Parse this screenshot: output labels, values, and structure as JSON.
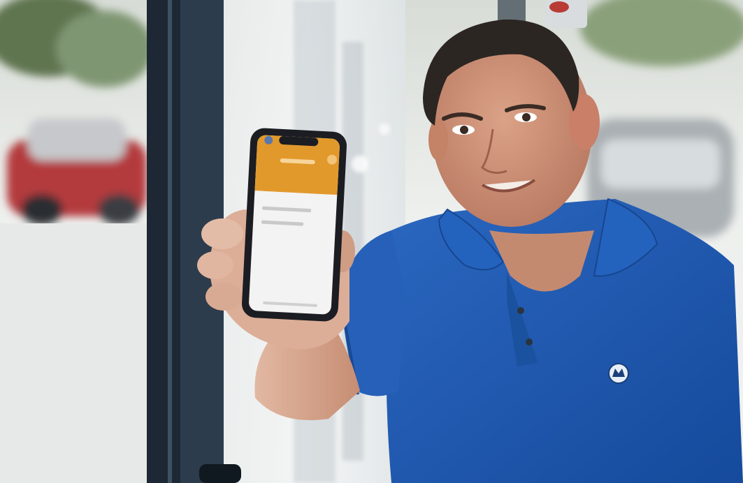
{
  "scene": {
    "subject": "person-holding-smartphone",
    "colors": {
      "background_light": "#e9ecec",
      "window_frame": "#1f2d3a",
      "shirt_blue": "#1e58b0",
      "skin": "#c98f74",
      "hair": "#2c2623",
      "phone_body": "#1b1d22",
      "phone_header_orange": "#e2992b",
      "phone_screen": "#f3f3f3",
      "car_red": "#b43a3e"
    },
    "icons": [
      "shirt-logo-icon"
    ]
  }
}
